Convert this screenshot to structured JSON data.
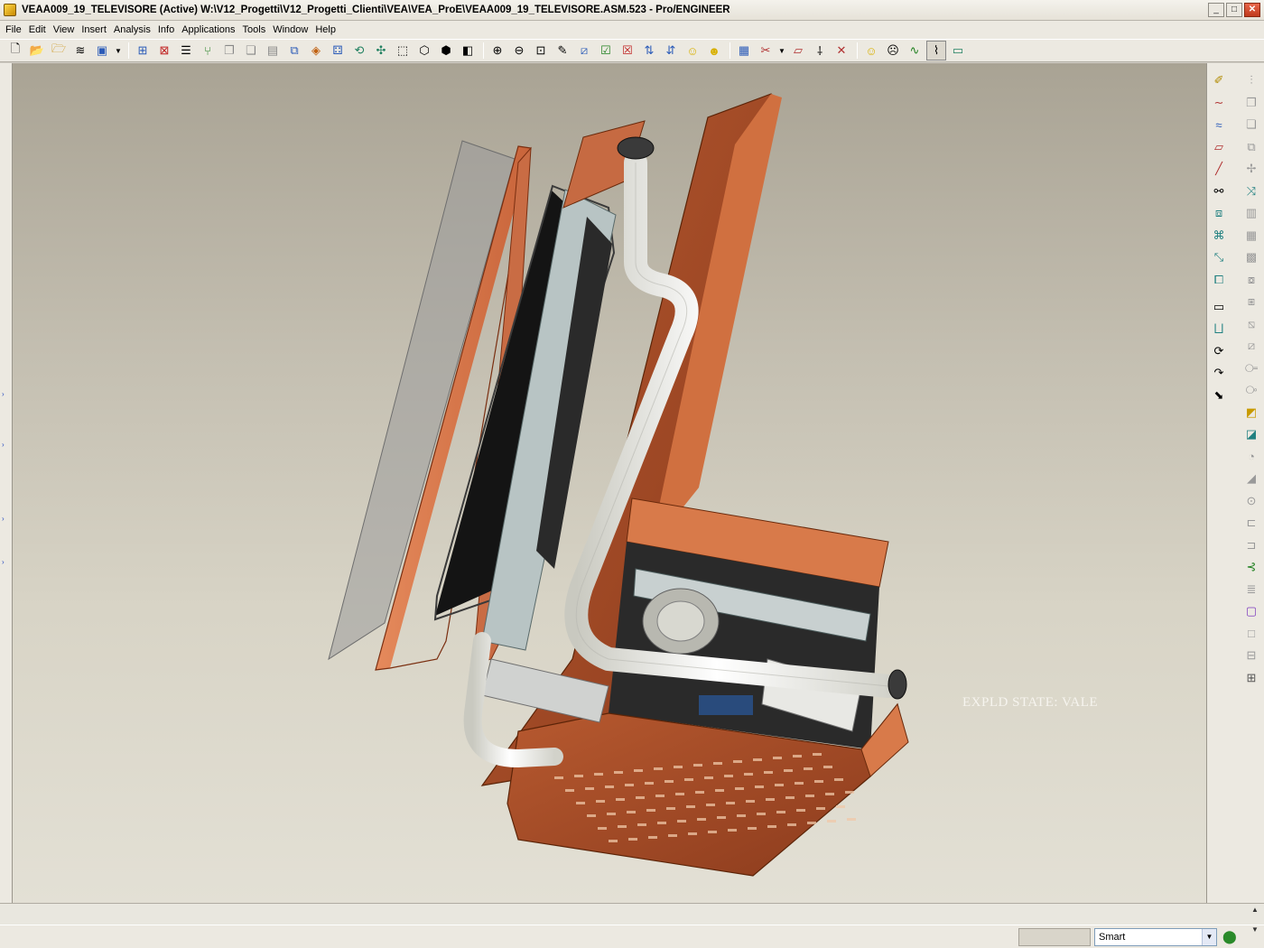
{
  "window": {
    "title": "VEAA009_19_TELEVISORE (Active) W:\\V12_Progetti\\V12_Progetti_Clienti\\VEA\\VEA_ProE\\VEAA009_19_TELEVISORE.ASM.523 - Pro/ENGINEER",
    "minimize": "_",
    "maximize": "□",
    "close": "✕"
  },
  "menu": [
    "File",
    "Edit",
    "View",
    "Insert",
    "Analysis",
    "Info",
    "Applications",
    "Tools",
    "Window",
    "Help"
  ],
  "toolbar": {
    "groups": [
      [
        "new-icon",
        "open-icon",
        "open-recent-icon",
        "layers-icon",
        "save-icon",
        "dropdown-icon"
      ],
      [
        "regenerate-icon",
        "erase-icon",
        "model-tree-icon",
        "connect-icon",
        "copy-icon",
        "paste-icon",
        "paste-special-icon",
        "spin-center-icon",
        "explode-icon",
        "component-icon",
        "shade-icon",
        "datum-icon",
        "view-box-icon",
        "hidden-line-icon",
        "no-hidden-icon",
        "shading-icon"
      ],
      [
        "zoom-in-icon",
        "zoom-out-icon",
        "refit-icon",
        "reorient-icon",
        "saved-views-icon",
        "repaint-icon",
        "close-icon",
        "plane-datum-icon",
        "axis-datum-icon",
        "smiley-icon",
        "smiley-alt-icon"
      ],
      [
        "save-view-icon",
        "trim-icon",
        "dropdown-icon",
        "sketch-icon",
        "point-icon",
        "coord-icon"
      ],
      [
        "smiley-happy-icon",
        "smiley-sad-icon",
        "curve-icon",
        "pipe-icon",
        "monitor-icon"
      ]
    ]
  },
  "viewport": {
    "explode_state_label": "EXPLD STATE: VALE"
  },
  "right_toolbar": {
    "column_a": [
      "sketch-plane-icon",
      "curve-through-points-icon",
      "datum-curve-icon",
      "plane-icon",
      "axis-icon",
      "binoculars-icon",
      "csys-icon",
      "datum-point-icon",
      "point-offset-icon",
      "surface-icon",
      "rectangle-icon",
      "profile-icon",
      "revolve-icon",
      "sweep-icon",
      "blend-icon"
    ],
    "column_b": [
      "mirror-icon",
      "copy-feature-icon",
      "paste-feature-icon",
      "pattern-icon",
      "move-icon",
      "transform-icon",
      "group-icon",
      "feature-icon",
      "array-icon",
      "merge-icon",
      "trim-feature-icon",
      "extend-icon",
      "offset-icon",
      "thicken-icon",
      "solidify-icon",
      "yellow-cube-icon",
      "cyan-cube-icon",
      "round-icon",
      "chamfer-icon",
      "hole-icon",
      "shell-icon",
      "rib-icon",
      "draft-icon",
      "spring-icon",
      "warp-icon",
      "box-icon",
      "table-icon",
      "note-icon"
    ]
  },
  "status": {
    "filter_value": "Smart"
  }
}
